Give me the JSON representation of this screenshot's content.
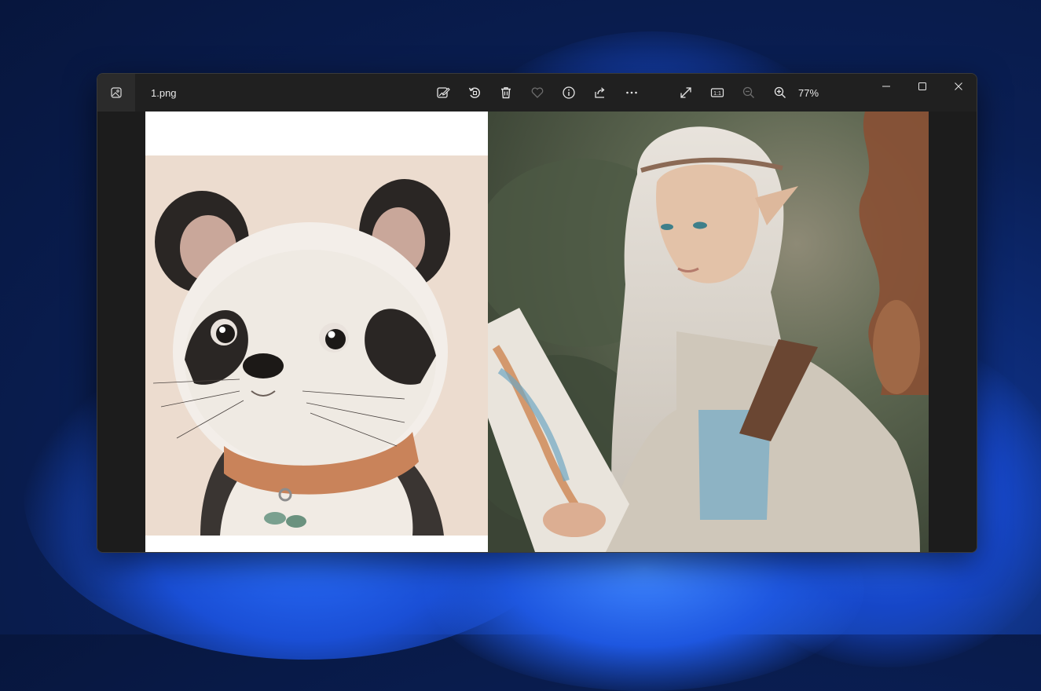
{
  "window": {
    "file_name": "1.png",
    "zoom_level": "77%"
  },
  "toolbar": {
    "buttons": [
      {
        "name": "edit-image",
        "icon": "edit-image-icon"
      },
      {
        "name": "rotate",
        "icon": "rotate-icon"
      },
      {
        "name": "delete",
        "icon": "trash-icon"
      },
      {
        "name": "favorite",
        "icon": "heart-icon"
      },
      {
        "name": "info",
        "icon": "info-icon"
      },
      {
        "name": "share",
        "icon": "share-icon"
      },
      {
        "name": "more",
        "icon": "more-icon"
      },
      {
        "name": "full-screen",
        "icon": "expand-icon"
      },
      {
        "name": "actual-size",
        "icon": "actual-size-icon"
      },
      {
        "name": "zoom-out",
        "icon": "zoom-out-icon"
      },
      {
        "name": "zoom-in",
        "icon": "zoom-in-icon"
      }
    ],
    "actual_size_label": "1:1"
  },
  "window_controls": [
    "minimize",
    "maximize",
    "close"
  ],
  "colors": {
    "titlebar": "#202020",
    "canvas": "#1c1c1c",
    "desktop_accent": "#1f56c8"
  }
}
